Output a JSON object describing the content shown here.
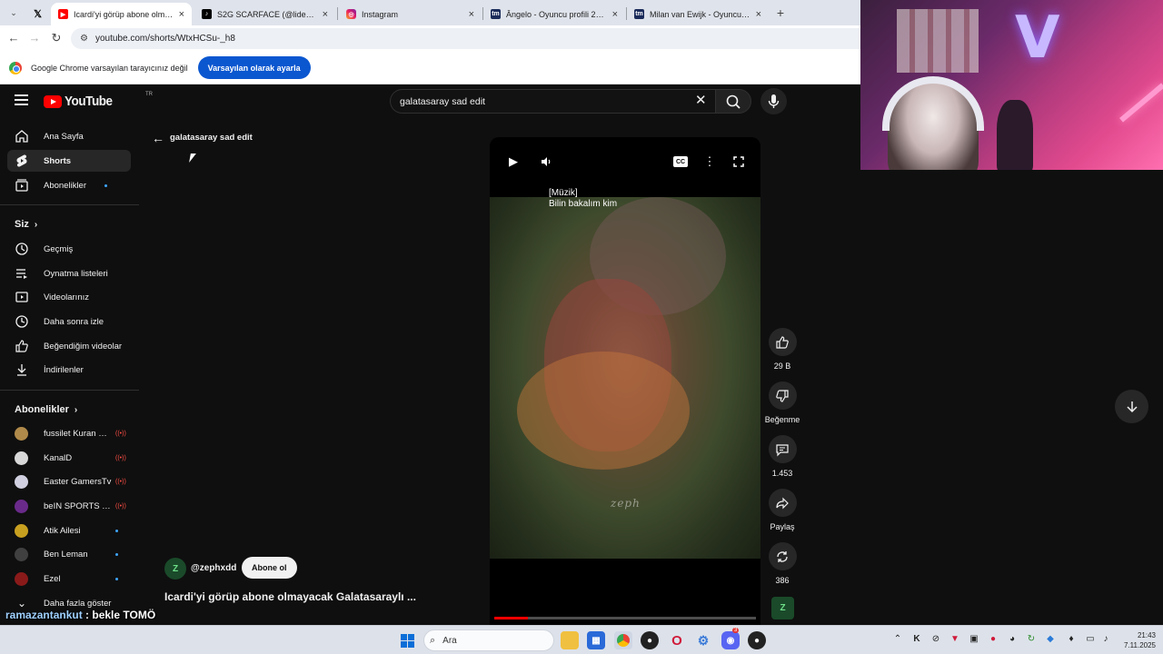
{
  "tabs": [
    {
      "title": "",
      "icon": "x-logo-icon"
    },
    {
      "title": "Icardi'yi görüp abone olmayacak",
      "icon": "youtube-icon",
      "active": true
    },
    {
      "title": "S2G SCARFACE (@liderscarface",
      "icon": "tiktok-icon"
    },
    {
      "title": "Instagram",
      "icon": "instagram-icon"
    },
    {
      "title": "Ângelo - Oyuncu profili 25/26 |",
      "icon": "transfermarkt-icon"
    },
    {
      "title": "Milan van Ewijk - Oyuncu profi",
      "icon": "transfermarkt-icon"
    }
  ],
  "address_bar": {
    "url": "youtube.com/shorts/WtxHCSu-_h8"
  },
  "infobar": {
    "message": "Google Chrome varsayılan tarayıcınız değil",
    "button": "Varsayılan olarak ayarla"
  },
  "youtube": {
    "logo_text": "YouTube",
    "country_code": "TR",
    "search_query": "galatasaray sad edit",
    "sidebar": {
      "main": [
        {
          "label": "Ana Sayfa",
          "icon": "home-icon"
        },
        {
          "label": "Shorts",
          "icon": "shorts-icon",
          "active": true
        },
        {
          "label": "Abonelikler",
          "icon": "subscriptions-icon"
        }
      ],
      "you_header": "Siz",
      "you": [
        {
          "label": "Geçmiş",
          "icon": "history-icon"
        },
        {
          "label": "Oynatma listeleri",
          "icon": "playlists-icon"
        },
        {
          "label": "Videolarınız",
          "icon": "your-videos-icon"
        },
        {
          "label": "Daha sonra izle",
          "icon": "watch-later-icon"
        },
        {
          "label": "Beğendiğim videolar",
          "icon": "liked-icon"
        },
        {
          "label": "İndirilenler",
          "icon": "downloads-icon"
        }
      ],
      "subs_header": "Abonelikler",
      "subscriptions": [
        {
          "name": "fussilet Kuran M...",
          "status": "live",
          "color": "#b08a4a"
        },
        {
          "name": "KanalD",
          "status": "live",
          "color": "#d8d8d8"
        },
        {
          "name": "Easter GamersTv",
          "status": "live",
          "color": "#d0d0e0"
        },
        {
          "name": "beIN SPORTS Tü...",
          "status": "live",
          "color": "#6a2a8a"
        },
        {
          "name": "Atik Ailesi",
          "status": "new",
          "color": "#c8a020"
        },
        {
          "name": "Ben Leman",
          "status": "new",
          "color": "#404040"
        },
        {
          "name": "Ezel",
          "status": "new",
          "color": "#8a1a1a"
        }
      ],
      "show_more": "Daha fazla göster"
    },
    "shorts": {
      "query_title": "galatasaray sad edit",
      "captions": [
        "[Müzik]",
        "Bilin bakalım kim"
      ],
      "watermark": "zeph",
      "channel": "@zephxdd",
      "channel_avatar_text": "Z",
      "subscribe": "Abone ol",
      "title": "Icardi'yi görüp abone olmayacak Galatasaraylı ...",
      "progress": 0.13,
      "actions": {
        "likes": "29 B",
        "dislike": "Beğenme",
        "comments": "1.453",
        "share": "Paylaş",
        "remix": "386"
      }
    }
  },
  "chat": {
    "user": "ramazantankut",
    "message": " : bekle TOMÖ"
  },
  "taskbar": {
    "search_placeholder": "Ara",
    "time": "21:43",
    "date": "7.11.2025",
    "discord_badge": "3"
  }
}
